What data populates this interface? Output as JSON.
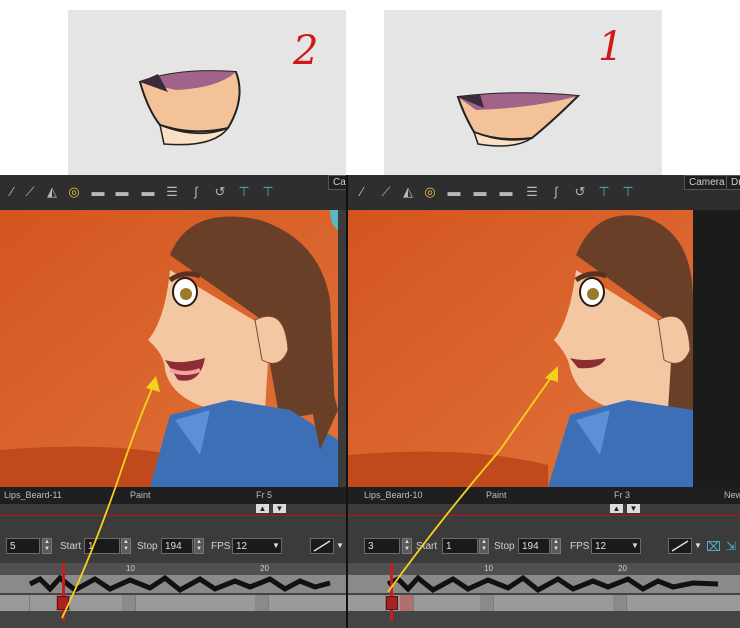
{
  "references": {
    "left_number": "2",
    "right_number": "1"
  },
  "left_panel": {
    "camera_tab": "Cam",
    "layer_name": "Lips_Beard-11",
    "mode": "Paint",
    "frame": "Fr 5",
    "current_frame": "5",
    "start_label": "Start",
    "start_value": "1",
    "stop_label": "Stop",
    "stop_value": "194",
    "fps_label": "FPS",
    "fps_value": "12",
    "ruler_marks": [
      "10",
      "20"
    ]
  },
  "right_panel": {
    "camera_tab": "Camera",
    "extra_tab": "Dra",
    "layer_name": "Lips_Beard-10",
    "mode": "Paint",
    "frame": "Fr 3",
    "new_label": "New",
    "current_frame": "3",
    "start_label": "Start",
    "start_value": "1",
    "stop_label": "Stop",
    "stop_value": "194",
    "fps_label": "FPS",
    "fps_value": "12",
    "ruler_marks": [
      "10",
      "20"
    ]
  },
  "colors": {
    "background_orange": "#d4541f",
    "arrow": "#f5d21a",
    "playhead": "#c42020",
    "number_red": "#d01818"
  }
}
